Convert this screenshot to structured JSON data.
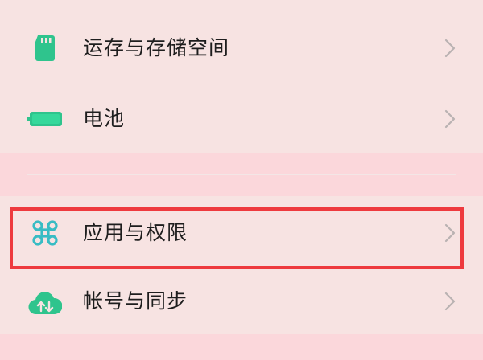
{
  "settings_list": {
    "items": [
      {
        "label": "运存与存储空间",
        "icon": "sd-card-icon",
        "icon_color": "#2fc48d"
      },
      {
        "label": "电池",
        "icon": "battery-icon",
        "icon_color": "#2fc48d"
      },
      {
        "label": "应用与权限",
        "icon": "command-icon",
        "icon_color": "#38bcc4"
      },
      {
        "label": "帐号与同步",
        "icon": "cloud-sync-icon",
        "icon_color": "#2fc48d"
      }
    ]
  },
  "highlight_color": "#ee3a3e",
  "chevron_icon": "chevron-right-icon"
}
